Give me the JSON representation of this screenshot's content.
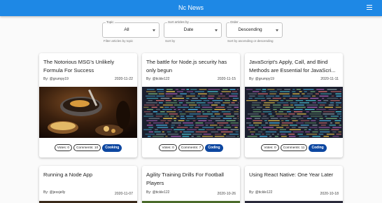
{
  "app": {
    "title": "Nc News"
  },
  "filters": {
    "topic": {
      "label": "Topic",
      "value": "All",
      "helper": "Filter articles by topic"
    },
    "sort": {
      "label": "Sort articles by",
      "value": "Date",
      "helper": "Sort by"
    },
    "order": {
      "label": "Order",
      "value": "Descending",
      "helper": "Sort by ascending or descending"
    }
  },
  "articles": [
    {
      "title": "The Notorious MSG’s Unlikely Formula For Success",
      "author": "By: @grumpy19",
      "date": "2020-11-22",
      "votes": "Votes: 0",
      "comments": "Comments: 10",
      "topic": "Cooking",
      "image": "food-pan"
    },
    {
      "title": "The battle for Node.js security has only begun",
      "author": "By: @tickle122",
      "date": "2020-11-15",
      "votes": "Votes: 0",
      "comments": "Comments: 7",
      "topic": "Coding",
      "image": "code-screen"
    },
    {
      "title": "JavaScript’s Apply, Call, and Bind Methods are Essential for JavaScri...",
      "author": "By: @grumpy19",
      "date": "2020-11-11",
      "votes": "Votes: 0",
      "comments": "Comments: 11",
      "topic": "Coding",
      "image": "code-screen"
    },
    {
      "title": "Running a Node App",
      "author": "By: @jessjelly",
      "date": "2020-11-07"
    },
    {
      "title": "Agility Training Drills For Football Players",
      "author": "By: @tickle122",
      "date": "2020-10-26"
    },
    {
      "title": "Using React Native: One Year Later",
      "author": "By: @tickle122",
      "date": "2020-10-18"
    }
  ],
  "colors": {
    "appbar": "#1e88e5",
    "topic_chip": "#0d47a1"
  }
}
